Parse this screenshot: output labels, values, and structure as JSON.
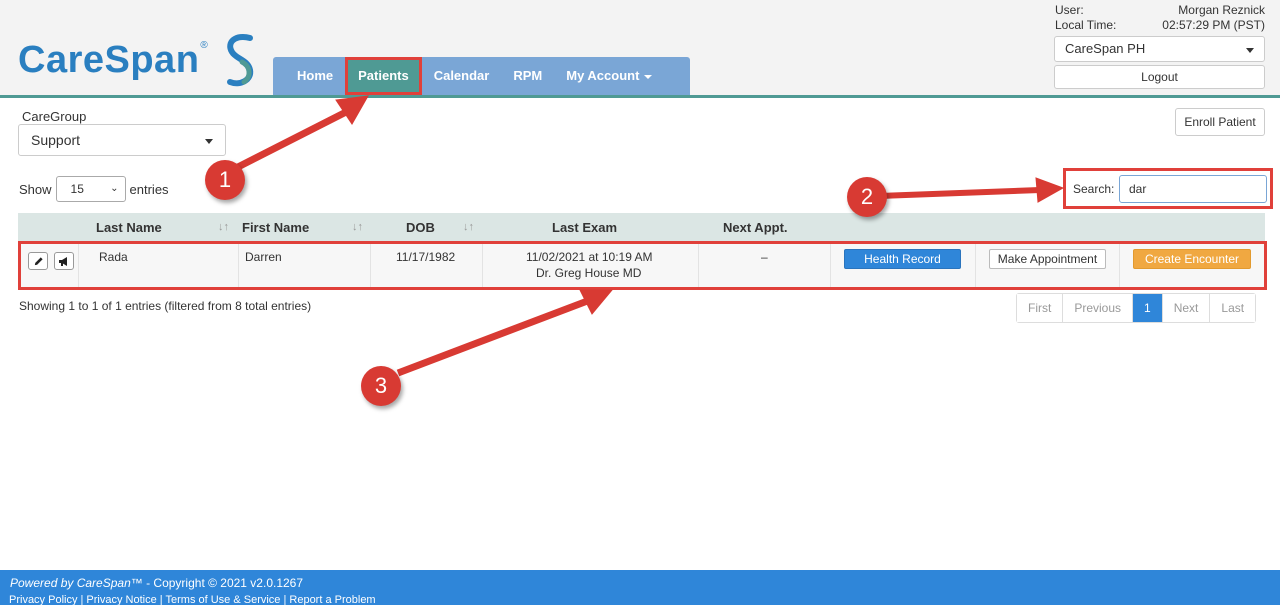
{
  "header": {
    "logo": "CareSpan",
    "logo_mark": "®",
    "nav": [
      {
        "label": "Home"
      },
      {
        "label": "Patients"
      },
      {
        "label": "Calendar"
      },
      {
        "label": "RPM"
      },
      {
        "label": "My Account"
      }
    ],
    "user_label": "User:",
    "user_name": "Morgan Reznick",
    "time_label": "Local Time:",
    "time_value": "02:57:29 PM (PST)",
    "org_value": "CareSpan PH",
    "logout_label": "Logout"
  },
  "filters": {
    "caregroup_label": "CareGroup",
    "caregroup_value": "Support",
    "enroll_label": "Enroll Patient",
    "show_label": "Show",
    "show_value": "15",
    "entries_label": "entries",
    "search_label": "Search:",
    "search_value": "dar"
  },
  "table": {
    "headers": [
      "Last Name",
      "First Name",
      "DOB",
      "Last Exam",
      "Next Appt."
    ],
    "row": {
      "last_name": "Rada",
      "first_name": "Darren",
      "dob": "11/17/1982",
      "last_exam": "11/02/2021 at 10:19 AM",
      "last_exam_doctor": "Dr. Greg House MD",
      "next_appt": "–",
      "health_record": "Health Record",
      "make_appointment": "Make Appointment",
      "create_encounter": "Create Encounter"
    },
    "info": "Showing 1 to 1 of 1 entries (filtered from 8 total entries)",
    "pager": [
      "First",
      "Previous",
      "1",
      "Next",
      "Last"
    ]
  },
  "annotations": [
    "1",
    "2",
    "3"
  ],
  "footer": {
    "powered": "Powered by CareSpan™",
    "copyright": " - Copyright © 2021 v2.0.1267",
    "links": "Privacy Policy  |  Privacy Notice  |  Terms of Use & Service   |  Report a Problem"
  },
  "colors": {
    "accent": "#4f9a94",
    "nav": "#7aa6d6",
    "primary": "#2f86d9",
    "annotation": "#e0403a",
    "orange": "#f0a841"
  }
}
